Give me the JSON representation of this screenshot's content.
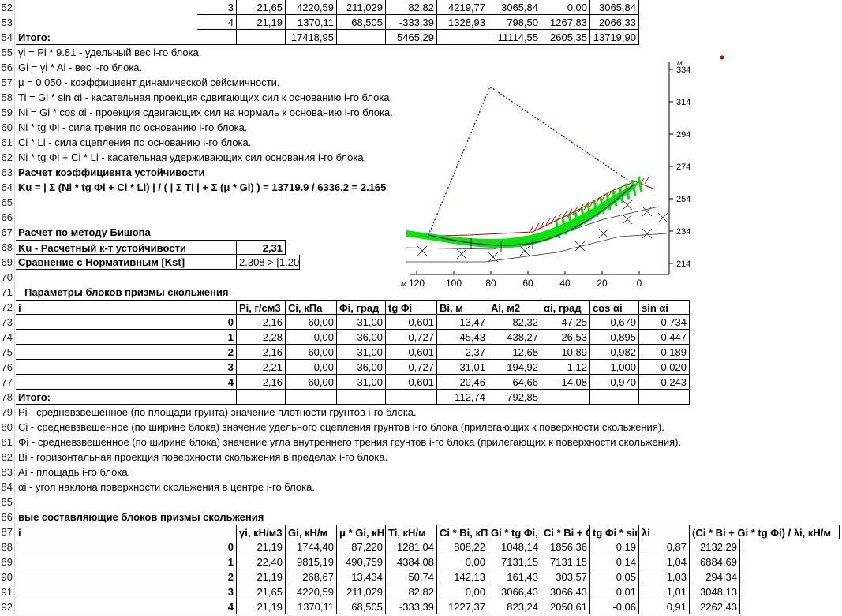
{
  "row_numbers": [
    "52",
    "53",
    "54",
    "55",
    "56",
    "57",
    "58",
    "59",
    "60",
    "61",
    "62",
    "63",
    "64",
    "65",
    "66",
    "67",
    "68",
    "69",
    "70",
    "71",
    "72",
    "73",
    "74",
    "75",
    "76",
    "77",
    "78",
    "79",
    "80",
    "81",
    "82",
    "83",
    "84",
    "85",
    "86",
    "87",
    "88",
    "89",
    "90",
    "91",
    "92"
  ],
  "top_table": {
    "rows": [
      {
        "i": "3",
        "c1": "21,65",
        "c2": "4220,59",
        "c3": "211,029",
        "c4": "82,82",
        "c5": "4219,77",
        "c6": "3065,84",
        "c7": "0,00",
        "c8": "3065,84"
      },
      {
        "i": "4",
        "c1": "21,19",
        "c2": "1370,11",
        "c3": "68,505",
        "c4": "-333,39",
        "c5": "1328,93",
        "c6": "798,50",
        "c7": "1267,83",
        "c8": "2066,33"
      }
    ],
    "total": {
      "label": "Итого:",
      "c2": "17418,95",
      "c4": "5465,29",
      "c6": "11114,55",
      "c7": "2605,35",
      "c8": "13719,90"
    }
  },
  "definitions1": [
    "γi = Pi * 9.81 - удельный вес i-го блока.",
    "Gi = γi * Ai - вес i-го блока.",
    "μ = 0.050 - коэффициент динамической сейсмичности.",
    "Ti = Gi * sin αi - касательная проекция сдвигающих сил к основанию i-го блока.",
    "Ni = Gi * cos αi - проекция сдвигающих сил на нормаль к основанию i-го блока.",
    "Ni * tg Φi - сила трения по основанию i-го блока.",
    "Ci * Li - сила сцепления по основанию i-го блока.",
    "Ni * tg Φi + Ci * Li - касательная удерживающих сил основания i-го блока."
  ],
  "calc_title": "Расчет коэффициента устойчивости",
  "ku_formula": "Ku = | Σ (Ni * tg Φi + Ci * Li) | / ( | Σ Ti | + Σ (μ * Gi) ) = 13719.9 / 6336.2 = 2.165",
  "bishop": {
    "title": "Расчет по методу Бишопа",
    "ku_label": "Ku - Расчетный к-т устойчивости",
    "ku_value": "2,31",
    "cmp_label": "Сравнение с Нормативным [Kst]",
    "cmp_value": "2.308 > [1.20]"
  },
  "params": {
    "title": "Параметры блоков призмы скольжения",
    "headers": [
      "i",
      "Pi, г/см3",
      "Ci, кПа",
      "Φi, град",
      "tg Φi",
      "Bi, м",
      "Ai, м2",
      "αi, град",
      "cos αi",
      "sin αi"
    ],
    "rows": [
      [
        "0",
        "2,16",
        "60,00",
        "31,00",
        "0,601",
        "13,47",
        "82,32",
        "47,25",
        "0,679",
        "0,734"
      ],
      [
        "1",
        "2,28",
        "0,00",
        "36,00",
        "0,727",
        "45,43",
        "438,27",
        "26,53",
        "0,895",
        "0,447"
      ],
      [
        "2",
        "2,16",
        "60,00",
        "31,00",
        "0,601",
        "2,37",
        "12,68",
        "10,89",
        "0,982",
        "0,189"
      ],
      [
        "3",
        "2,21",
        "0,00",
        "36,00",
        "0,727",
        "31,01",
        "194,92",
        "1,12",
        "1,000",
        "0,020"
      ],
      [
        "4",
        "2,16",
        "60,00",
        "31,00",
        "0,601",
        "20,46",
        "64,66",
        "-14,08",
        "0,970",
        "-0,243"
      ]
    ],
    "total": {
      "label": "Итого:",
      "bi": "112,74",
      "ai": "792,85"
    }
  },
  "definitions2": [
    "Pi - средневзвешенное (по площади грунта) значение плотности грунтов i-го блока.",
    "Ci - средневзвешенное (по ширине блока) значение удельного сцепления грунтов i-го блока (прилегающих к поверхности скольжения).",
    "Φi - средневзвешенное (по ширине блока) значение угла внутреннего трения грунтов i-го блока (прилегающих к поверхности скольжения).",
    "Bi - горизонтальная проекция поверхности скольжения в пределах i-го блока.",
    "Ai - площадь i-го блока.",
    "αi - угол наклона поверхности скольжения в центре i-го блока."
  ],
  "forces": {
    "title": "вые составляющие блоков призмы скольжения",
    "headers": [
      "i",
      "γi, кН/м3",
      "Gi, кН/м",
      "μ * Gi, кН",
      "Ti, кН/м",
      "Ci * Bi, кП",
      "Gi * tg Φi,",
      "Ci * Bi + G",
      "tg Φi * sin",
      "λi",
      "(Ci * Bi + Gi * tg Φi) / λi, кН/м"
    ],
    "rows": [
      [
        "0",
        "21,19",
        "1744,40",
        "87,220",
        "1281,04",
        "808,22",
        "1048,14",
        "1856,36",
        "0,19",
        "0,87",
        "2132,29"
      ],
      [
        "1",
        "22,40",
        "9815,19",
        "490,759",
        "4384,08",
        "0,00",
        "7131,15",
        "7131,15",
        "0,14",
        "1,04",
        "6884,69"
      ],
      [
        "2",
        "21,19",
        "268,67",
        "13,434",
        "50,74",
        "142,13",
        "161,43",
        "303,57",
        "0,05",
        "1,03",
        "294,34"
      ],
      [
        "3",
        "21,65",
        "4220,59",
        "211,029",
        "82,82",
        "0,00",
        "3066,43",
        "3066,43",
        "0,01",
        "1,01",
        "3048,13"
      ],
      [
        "4",
        "21,19",
        "1370,11",
        "68,505",
        "-333,39",
        "1227,37",
        "823,24",
        "2050,61",
        "-0,06",
        "0,91",
        "2262,43"
      ]
    ]
  },
  "chart_data": {
    "type": "diagram",
    "y_unit": "м",
    "x_unit": "м",
    "y_ticks": [
      "334",
      "314",
      "294",
      "274",
      "254",
      "234",
      "214"
    ],
    "x_ticks": [
      "120",
      "100",
      "80",
      "60",
      "40",
      "20",
      "0"
    ],
    "colors": {
      "slip_band": "#00e000",
      "search_grid": "#0000cc",
      "red_hatch": "#cc0000",
      "surface": "#1a1a8c"
    }
  }
}
